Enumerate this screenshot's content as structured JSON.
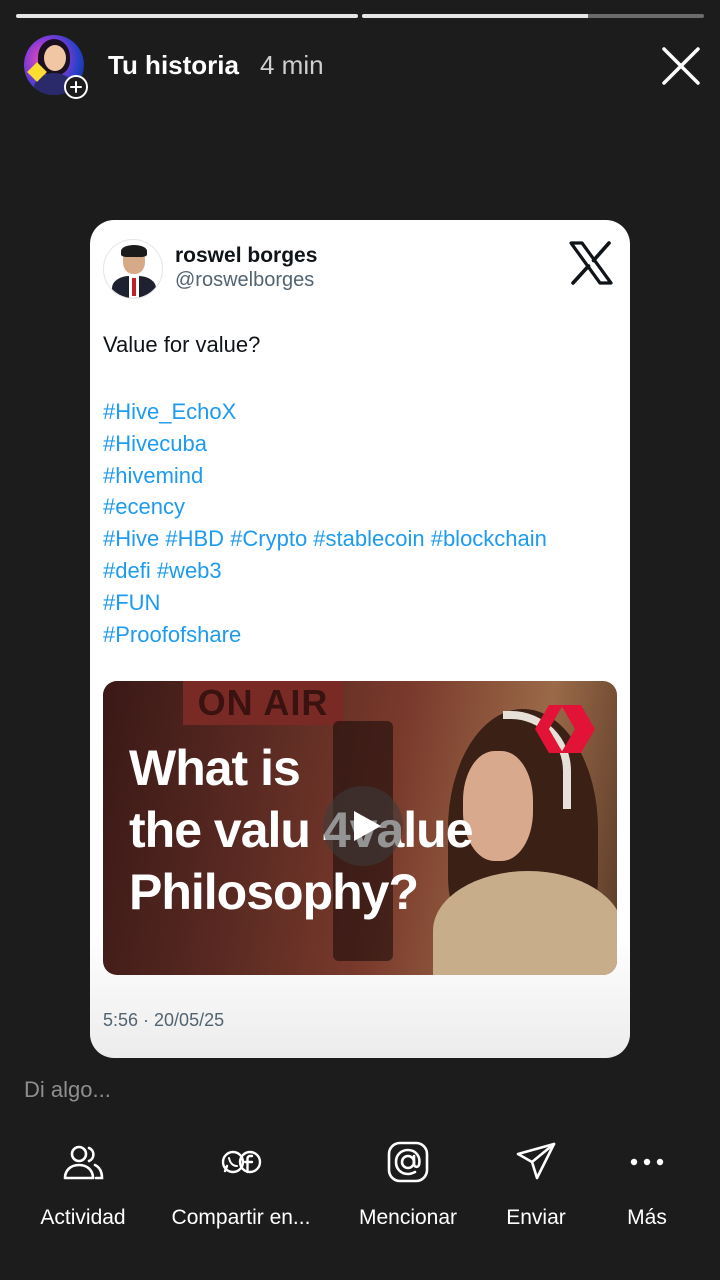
{
  "header": {
    "progress": [
      1.0,
      0.66
    ],
    "title": "Tu historia",
    "time": "4 min"
  },
  "tweet": {
    "name": "roswel borges",
    "handle": "@roswelborges",
    "text": "Value for value?",
    "hashtag_lines": [
      "#Hive_EchoX",
      "#Hivecuba",
      "#hivemind",
      "#ecency",
      "#Hive #HBD #Crypto #stablecoin #blockchain",
      "#defi #web3",
      "#FUN",
      "#Proofofshare"
    ],
    "media": {
      "sign": "ON AIR",
      "headline_lines": [
        "What is",
        "the valu 4value",
        "Philosophy?"
      ]
    },
    "timestamp": "5:56 · 20/05/25"
  },
  "reply": {
    "placeholder": "Di algo..."
  },
  "actions": [
    {
      "label": "Actividad",
      "icon": "people-icon"
    },
    {
      "label": "Compartir en...",
      "icon": "whatsapp-facebook-icon"
    },
    {
      "label": "Mencionar",
      "icon": "at-icon"
    },
    {
      "label": "Enviar",
      "icon": "send-icon"
    },
    {
      "label": "Más",
      "icon": "more-icon"
    }
  ],
  "colors": {
    "background": "#1c1c1c",
    "hashtag": "#1d9bf0",
    "secondary_text": "#536471"
  }
}
